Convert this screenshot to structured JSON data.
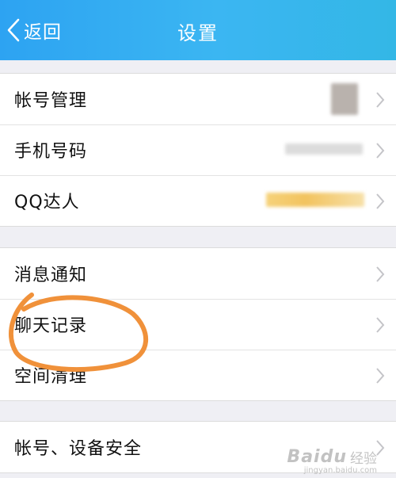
{
  "header": {
    "back_label": "返回",
    "title": "设置"
  },
  "groups": [
    {
      "items": [
        "帐号管理",
        "手机号码",
        "QQ达人"
      ]
    },
    {
      "items": [
        "消息通知",
        "聊天记录",
        "空间清理"
      ]
    },
    {
      "items": [
        "帐号、设备安全"
      ]
    }
  ],
  "annotation": {
    "color": "#f0913a"
  },
  "watermark": {
    "logo": "Baidu",
    "text": "经验",
    "url": "jingyan.baidu.com"
  },
  "colors": {
    "nav_start": "#2da3f2",
    "nav_end": "#33b7e6",
    "background": "#efeff4"
  }
}
